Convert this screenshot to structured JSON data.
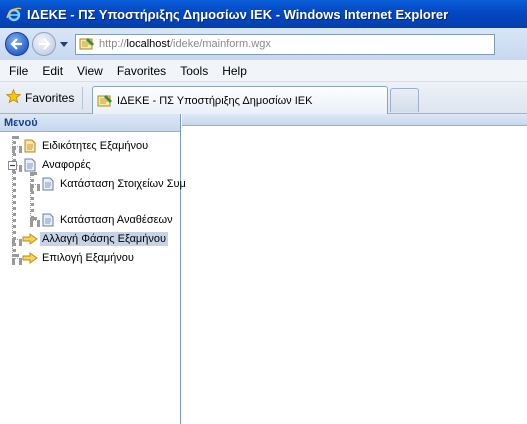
{
  "window": {
    "title": "ΙΔΕΚΕ - ΠΣ Υποστήριξης Δημοσίων ΙΕΚ - Windows Internet Explorer"
  },
  "address_bar": {
    "url_proto": "http://",
    "url_host": "localhost",
    "url_path": "/ideke/mainform.wgx"
  },
  "menu": {
    "items": [
      "File",
      "Edit",
      "View",
      "Favorites",
      "Tools",
      "Help"
    ]
  },
  "favorites_bar": {
    "favorites_label": "Favorites",
    "active_tab_title": "ΙΔΕΚΕ - ΠΣ Υποστήριξης Δημοσίων ΙΕΚ"
  },
  "left_panel": {
    "header": "Μενού",
    "tree": [
      {
        "label": "Ειδικότητες Εξαμήνου",
        "icon": "document-icon",
        "selected": false
      },
      {
        "label": "Αναφορές",
        "icon": "report-icon",
        "selected": false
      },
      {
        "label": "Κατάσταση Στοιχείων Συμ",
        "icon": "report-icon",
        "selected": false
      },
      {
        "label": "Κατάσταση Αναθέσεων",
        "icon": "report-icon",
        "selected": false
      },
      {
        "label": "Αλλαγή Φάσης Εξαμήνου",
        "icon": "arrow-icon",
        "selected": true
      },
      {
        "label": "Επιλογή Εξαμήνου",
        "icon": "arrow-icon",
        "selected": false
      }
    ]
  },
  "colors": {
    "titlebar": "#0548c6",
    "selection": "#c6d3e6",
    "panel_header_text": "#15428b"
  }
}
